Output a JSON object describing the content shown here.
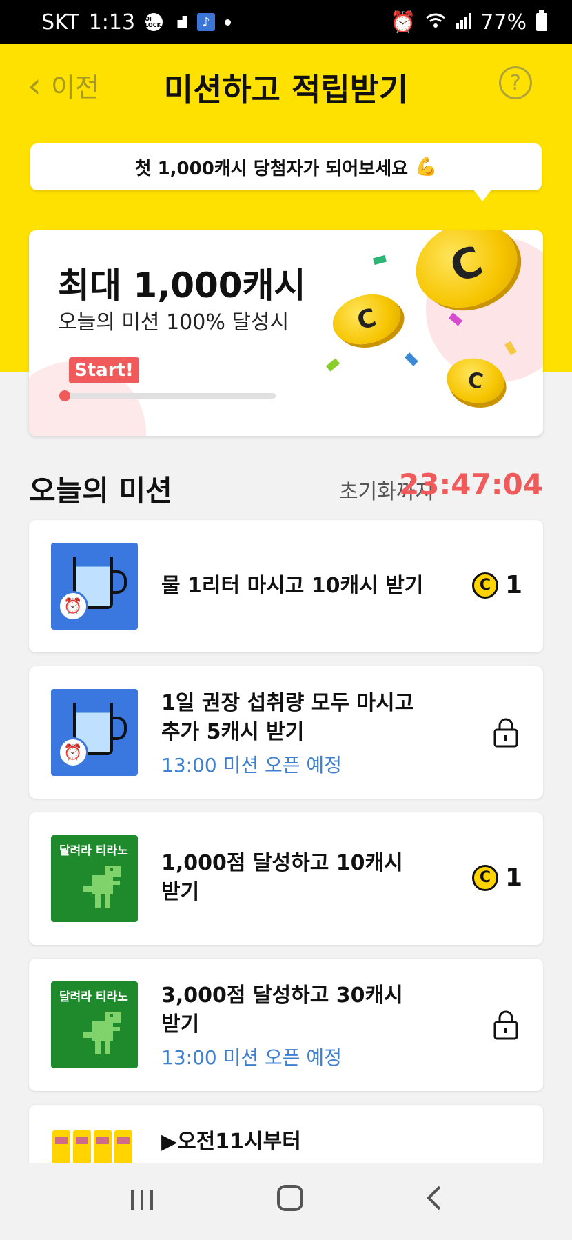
{
  "status_bar": {
    "carrier": "SKT",
    "time": "1:13",
    "lock_badge": "OI LOCK",
    "battery": "77%"
  },
  "header": {
    "back_label": "이전",
    "title": "미션하고 적립받기",
    "help_label": "?"
  },
  "bubble": {
    "text": "첫 1,000캐시 당첨자가 되어보세요"
  },
  "promo": {
    "title": "최대 1,000캐시",
    "subtitle": "오늘의 미션 100% 달성시",
    "start_label": "Start!",
    "progress": 0
  },
  "section": {
    "title": "오늘의 미션",
    "reset_label": "초기화까지",
    "reset_timer": "23:47:04"
  },
  "missions": [
    {
      "title": "물 1리터 마시고 10캐시 받기",
      "subtitle": "",
      "reward": "1",
      "locked": false
    },
    {
      "title": "1일 권장 섭취량 모두 마시고",
      "title2": "추가 5캐시 받기",
      "subtitle": "13:00 미션 오픈 예정",
      "locked": true
    },
    {
      "title": "1,000점 달성하고 10캐시",
      "title2": "받기",
      "subtitle": "",
      "reward": "1",
      "locked": false
    },
    {
      "title": "3,000점 달성하고 30캐시",
      "title2": "받기",
      "subtitle": "13:00 미션 오픈 예정",
      "locked": true
    },
    {
      "title": "▶오전11시부터"
    }
  ],
  "thumb_labels": {
    "dino": "달려라 티라노"
  },
  "coin_symbol": "C",
  "colors": {
    "header_yellow": "#ffe100",
    "accent_red": "#f05a5a",
    "link_blue": "#3d7fd0",
    "coin_yellow": "#ffd400"
  }
}
